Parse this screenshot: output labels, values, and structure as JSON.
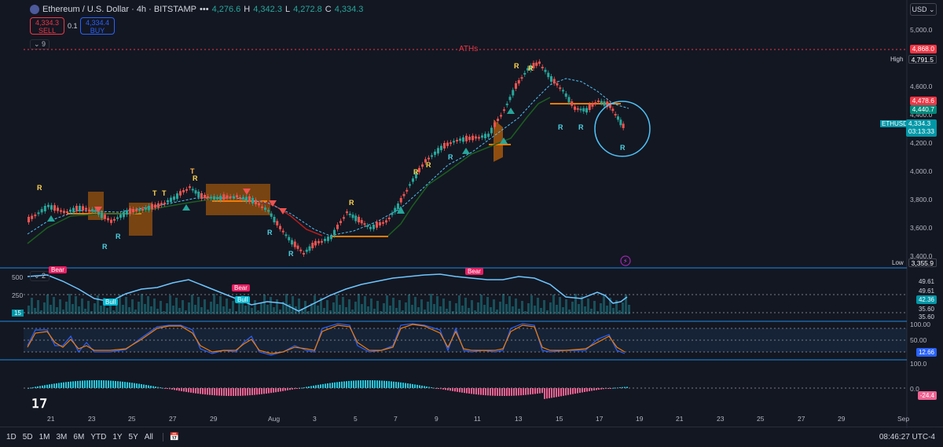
{
  "header": {
    "title": "Ethereum / U.S. Dollar · 4h · BITSTAMP",
    "menu_dots": "•••",
    "o": "4,276.6",
    "h_label": "H",
    "h": "4,342.3",
    "l_label": "L",
    "l": "4,272.8",
    "c_label": "C",
    "c": "4,334.3",
    "sell_price": "4,334.3",
    "sell_label": "SELL",
    "buy_price": "4,334.4",
    "buy_label": "BUY",
    "spread": "0.1",
    "indicators_count": "9",
    "currency": "USD"
  },
  "main_pane": {
    "ath_label": "ATHs",
    "price_axis": [
      "5,000.0",
      "4,600.0",
      "4,400.0",
      "4,200.0",
      "4,000.0",
      "3,800.0",
      "3,600.0",
      "3,400.0"
    ],
    "ath_price": "4,868.0",
    "high_label": "High",
    "high_price": "4,791.5",
    "red_price": "4,478.6",
    "blue_price": "4,440.7",
    "symbol_tag": "ETHUSD",
    "last_price": "4,334.3",
    "countdown": "03:13:33",
    "low_label": "Low",
    "low_price": "3,355.9",
    "signal_letters": [
      "R",
      "R",
      "T",
      "T",
      "T",
      "R",
      "R",
      "R",
      "R",
      "R",
      "R",
      "R",
      "R",
      "R",
      "R",
      "R",
      "R",
      "R"
    ]
  },
  "osc_pane1": {
    "collapse_count": "2",
    "axis": [
      "500",
      "250"
    ],
    "left_tag": "15",
    "labels": [
      "Bear",
      "Bull",
      "Bear",
      "Bull",
      "Bear"
    ],
    "right_values": [
      "49.61",
      "49.61",
      "42.36",
      "35.60",
      "35.60"
    ]
  },
  "osc_pane2": {
    "axis": [
      "100.00",
      "50.00",
      "12.66",
      "100.0"
    ]
  },
  "osc_pane3": {
    "axis": [
      "0.0",
      "-24.4"
    ]
  },
  "time_axis": [
    "21",
    "23",
    "25",
    "27",
    "29",
    "Aug",
    "3",
    "5",
    "7",
    "9",
    "11",
    "13",
    "15",
    "17",
    "19",
    "21",
    "23",
    "25",
    "27",
    "29",
    "Sep"
  ],
  "bottom_bar": {
    "timeframes": [
      "1D",
      "5D",
      "1M",
      "3M",
      "6M",
      "YTD",
      "1Y",
      "5Y",
      "All"
    ],
    "clock": "08:46:27 UTC-4"
  },
  "colors": {
    "bg": "#131722",
    "up": "#26a69a",
    "down": "#ef5350",
    "accent": "#2962ff",
    "orange": "#f57c00"
  }
}
